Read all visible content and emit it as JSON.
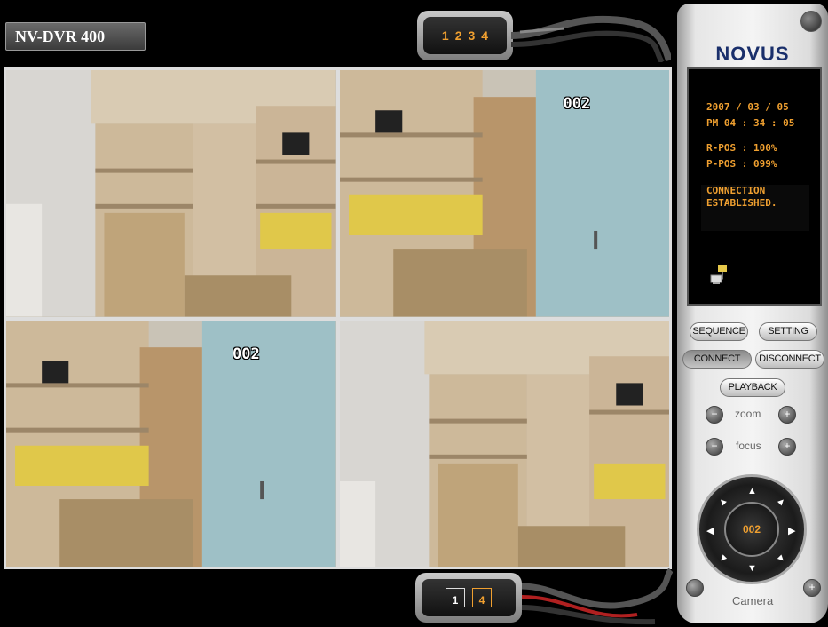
{
  "app": {
    "title": "NV-DVR 400"
  },
  "camera_select": {
    "buttons": [
      "1",
      "2",
      "3",
      "4"
    ]
  },
  "overlays": {
    "cam2_id": "002",
    "cam3_id": "002"
  },
  "layout_select": {
    "single": "1",
    "quad": "4"
  },
  "panel": {
    "logo": "NOVUS",
    "date": "2007 / 03 / 05",
    "time": "PM 04 : 34 : 05",
    "r_pos": "R-POS : 100%",
    "p_pos": "P-POS : 099%",
    "connection_line1": "CONNECTION",
    "connection_line2": "ESTABLISHED.",
    "buttons": {
      "sequence": "SEQUENCE",
      "setting": "SETTING",
      "connect": "CONNECT",
      "disconnect": "DISCONNECT",
      "playback": "PLAYBACK"
    },
    "zoom_label": "zoom",
    "focus_label": "focus",
    "ptz_camera": "002",
    "camera_label": "Camera"
  },
  "colors": {
    "accent": "#f0a030",
    "logo": "#1a2f6b"
  },
  "icons": [
    "close-icon",
    "network-icon",
    "zoom-out-icon",
    "zoom-in-icon",
    "focus-near-icon",
    "focus-far-icon",
    "arrow-icons",
    "prev-camera-icon",
    "next-camera-icon"
  ]
}
